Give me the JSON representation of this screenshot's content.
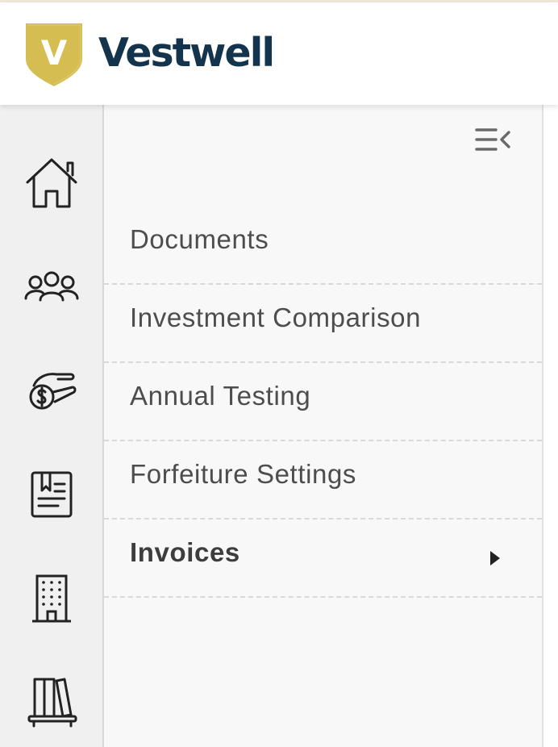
{
  "brand": {
    "name": "Vestwell",
    "logo_letter": "V",
    "logo_color": "#d6bd52",
    "text_color": "#14344d"
  },
  "rail": {
    "items": [
      {
        "icon": "house-icon"
      },
      {
        "icon": "people-group-icon"
      },
      {
        "icon": "hand-coin-icon"
      },
      {
        "icon": "document-list-icon"
      },
      {
        "icon": "building-icon"
      },
      {
        "icon": "bookshelf-icon"
      }
    ]
  },
  "panel": {
    "collapse_icon": "collapse-menu-icon",
    "menu": [
      {
        "label": "Documents"
      },
      {
        "label": "Investment Comparison"
      },
      {
        "label": "Annual Testing"
      },
      {
        "label": "Forfeiture Settings"
      },
      {
        "label": "Invoices",
        "active": true,
        "icon": "caret-right-icon"
      }
    ]
  },
  "colors": {
    "icon_stroke": "#222222",
    "menu_text": "#4d4d4d",
    "divider": "#d9d9d9"
  }
}
